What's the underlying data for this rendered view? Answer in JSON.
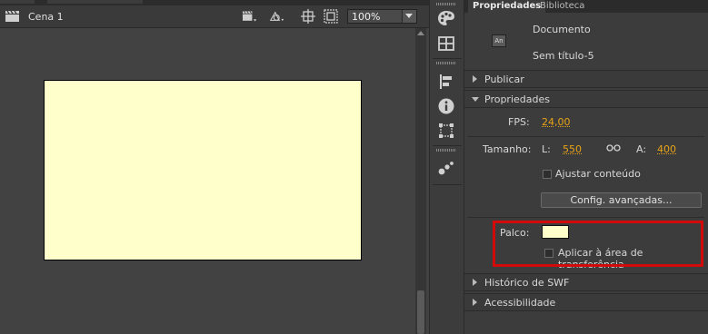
{
  "stage": {
    "scene_label": "Cena 1",
    "zoom": "100%",
    "stage_color": "#ffffcc"
  },
  "toolbar_icons": [
    "clapper-icon",
    "edit-scene-icon",
    "edit-symbol-icon",
    "center-stage-icon",
    "clip-icon"
  ],
  "tools": [
    "color-palette-icon",
    "grid-icon",
    "align-icon",
    "info-icon",
    "transform-icon",
    "motion-presets-icon"
  ],
  "panel": {
    "tabs": [
      {
        "label": "Propriedades",
        "active": true
      },
      {
        "label": "Biblioteca",
        "active": false
      }
    ],
    "doc_icon": "An",
    "doc_type": "Documento",
    "doc_name": "Sem título-5",
    "sections": {
      "publicar": "Publicar",
      "propriedades": "Propriedades",
      "historico": "Histórico de SWF",
      "acessibilidade": "Acessibilidade"
    },
    "fps_label": "FPS:",
    "fps_value": "24,00",
    "size_label": "Tamanho:",
    "width_label": "L:",
    "width_value": "550",
    "height_label": "A:",
    "height_value": "400",
    "fit_content_label": "Ajustar conteúdo",
    "advanced_button": "Config. avançadas...",
    "stage_label": "Palco:",
    "apply_pasteboard_label": "Aplicar à área de transferência"
  },
  "colors": {
    "accent_value": "#e8a317",
    "highlight": "#d30a0a"
  }
}
